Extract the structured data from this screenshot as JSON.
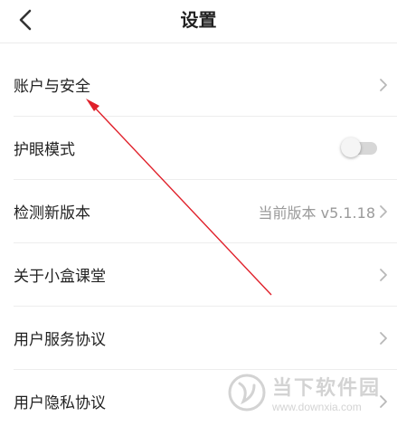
{
  "header": {
    "title": "设置",
    "back_icon": "chevron-left-icon"
  },
  "settings": {
    "items": [
      {
        "label": "账户与安全"
      },
      {
        "label": "护眼模式",
        "toggle_on": false
      },
      {
        "label": "检测新版本",
        "value": "当前版本 v5.1.18"
      },
      {
        "label": "关于小盒课堂"
      },
      {
        "label": "用户服务协议"
      },
      {
        "label": "用户隐私协议"
      }
    ]
  },
  "annotation": {
    "color": "#e0202a"
  },
  "watermark": {
    "name": "当下软件园",
    "url": "www.downxia.com"
  },
  "colors": {
    "text": "#222222",
    "secondary_text": "#9a9a9a",
    "divider": "#ededed",
    "chevron": "#b8b8b8"
  }
}
